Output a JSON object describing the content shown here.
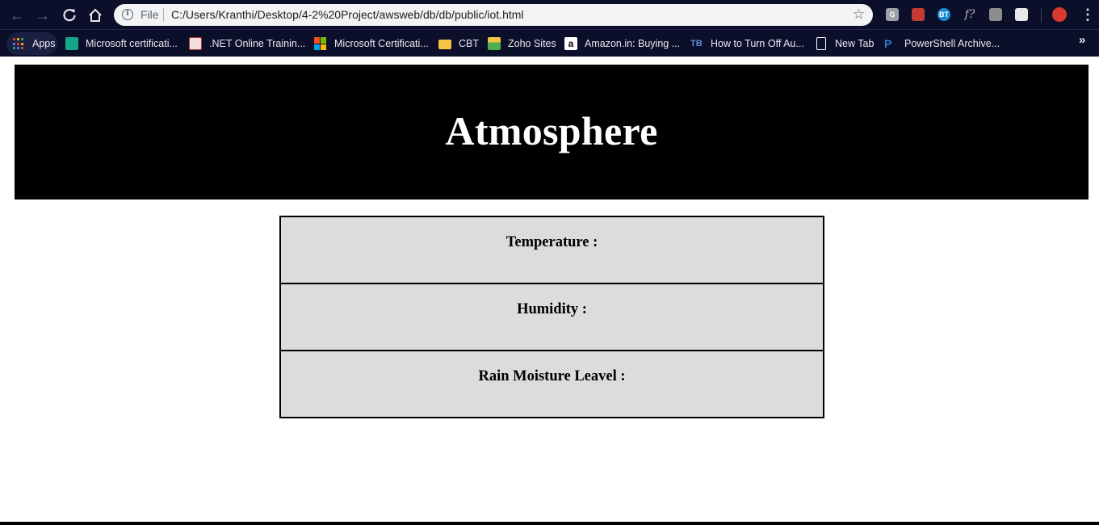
{
  "browser": {
    "scheme_label": "File",
    "url": "C:/Users/Kranthi/Desktop/4-2%20Project/awsweb/db/db/public/iot.html",
    "extensions": [
      {
        "name": "extension-g-icon",
        "text": "G",
        "color": "#9aa0a6"
      },
      {
        "name": "extension-red-icon",
        "text": "",
        "color": "#c23b31"
      },
      {
        "name": "extension-bt-icon",
        "text": "BT",
        "color": "#1a8ad4"
      },
      {
        "name": "extension-formula-icon",
        "text": "f?",
        "color": "transparent"
      },
      {
        "name": "extension-qr-icon",
        "text": "",
        "color": "#8d8d8d"
      },
      {
        "name": "extension-white-icon",
        "text": "",
        "color": "#e8e8e8"
      },
      {
        "name": "profile-avatar-icon",
        "text": "",
        "color": "#d83a2e"
      }
    ]
  },
  "bookmarks": {
    "apps_label": "Apps",
    "items": [
      {
        "label": "Microsoft certificati...",
        "icon": "teal-square-icon",
        "color": "#17a589"
      },
      {
        "label": ".NET Online Trainin...",
        "icon": "net-training-icon",
        "color": "#b03a2e"
      },
      {
        "label": "Microsoft Certificati...",
        "icon": "microsoft-logo-icon",
        "color": "#f25022"
      },
      {
        "label": "CBT",
        "icon": "folder-icon",
        "color": "#f5c542"
      },
      {
        "label": "Zoho Sites",
        "icon": "zoho-icon",
        "color": "#4caf50"
      },
      {
        "label": "Amazon.in: Buying ...",
        "icon": "amazon-icon",
        "color": "#ffffff"
      },
      {
        "label": "How to Turn Off Au...",
        "icon": "tb-icon",
        "color": "#2e5fa8"
      },
      {
        "label": "New Tab",
        "icon": "page-icon",
        "color": "#ffffff"
      },
      {
        "label": "PowerShell Archive...",
        "icon": "powershell-icon",
        "color": "#2d7fd3"
      }
    ],
    "more_label": "»"
  },
  "page": {
    "title": "Atmosphere",
    "readings": [
      {
        "label": "Temperature :"
      },
      {
        "label": "Humidity :"
      },
      {
        "label": "Rain Moisture Leavel :"
      }
    ]
  }
}
